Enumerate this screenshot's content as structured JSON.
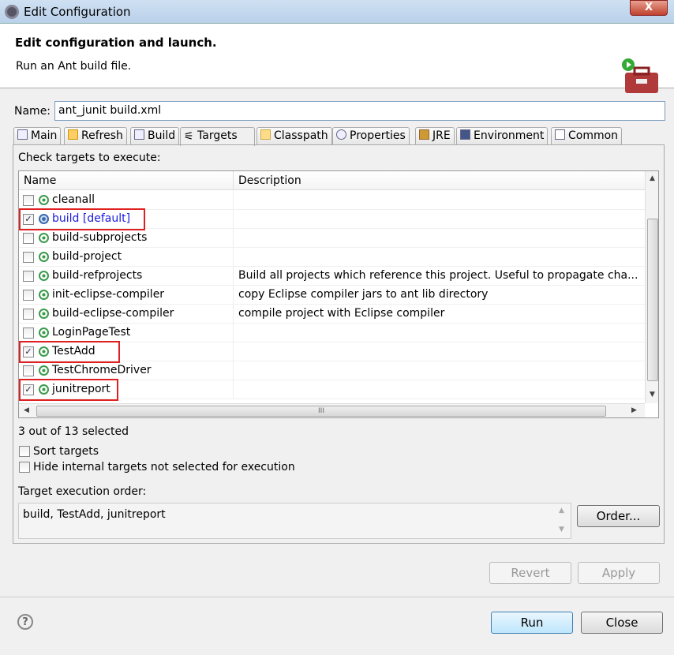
{
  "window": {
    "title": "Edit Configuration",
    "close_label": "X"
  },
  "header": {
    "title": "Edit configuration and launch.",
    "subtitle": "Run an Ant build file."
  },
  "name": {
    "label": "Name:",
    "value": "ant_junit build.xml"
  },
  "tabs": [
    {
      "label": "Main"
    },
    {
      "label": "Refresh"
    },
    {
      "label": "Build"
    },
    {
      "label": "Targets",
      "active": true
    },
    {
      "label": "Classpath"
    },
    {
      "label": "Properties"
    },
    {
      "label": "JRE"
    },
    {
      "label": "Environment"
    },
    {
      "label": "Common"
    }
  ],
  "targets": {
    "instruction": "Check targets to execute:",
    "columns": [
      "Name",
      "Description"
    ],
    "rows": [
      {
        "name": "cleanall",
        "description": "",
        "checked": false
      },
      {
        "name": "build [default]",
        "description": "",
        "checked": true,
        "default": true
      },
      {
        "name": "build-subprojects",
        "description": "",
        "checked": false
      },
      {
        "name": "build-project",
        "description": "",
        "checked": false
      },
      {
        "name": "build-refprojects",
        "description": "Build all projects which reference this project. Useful to propagate cha...",
        "checked": false
      },
      {
        "name": "init-eclipse-compiler",
        "description": "copy Eclipse compiler jars to ant lib directory",
        "checked": false
      },
      {
        "name": "build-eclipse-compiler",
        "description": "compile project with Eclipse compiler",
        "checked": false
      },
      {
        "name": "LoginPageTest",
        "description": "",
        "checked": false
      },
      {
        "name": "TestAdd",
        "description": "",
        "checked": true
      },
      {
        "name": "TestChromeDriver",
        "description": "",
        "checked": false
      },
      {
        "name": "junitreport",
        "description": "",
        "checked": true
      }
    ],
    "selected_count": "3 out of 13 selected",
    "hscroll_grip": "III"
  },
  "options": {
    "sort": "Sort targets",
    "hide": "Hide internal targets not selected for execution"
  },
  "order": {
    "label": "Target execution order:",
    "value": "build, TestAdd, junitreport",
    "button": "Order..."
  },
  "buttons": {
    "revert": "Revert",
    "apply": "Apply",
    "run": "Run",
    "close": "Close",
    "help": "?"
  },
  "colors": {
    "highlight": "#e02020",
    "default_target": "#1a1ae0",
    "target_icon": "#3a9a4a"
  }
}
